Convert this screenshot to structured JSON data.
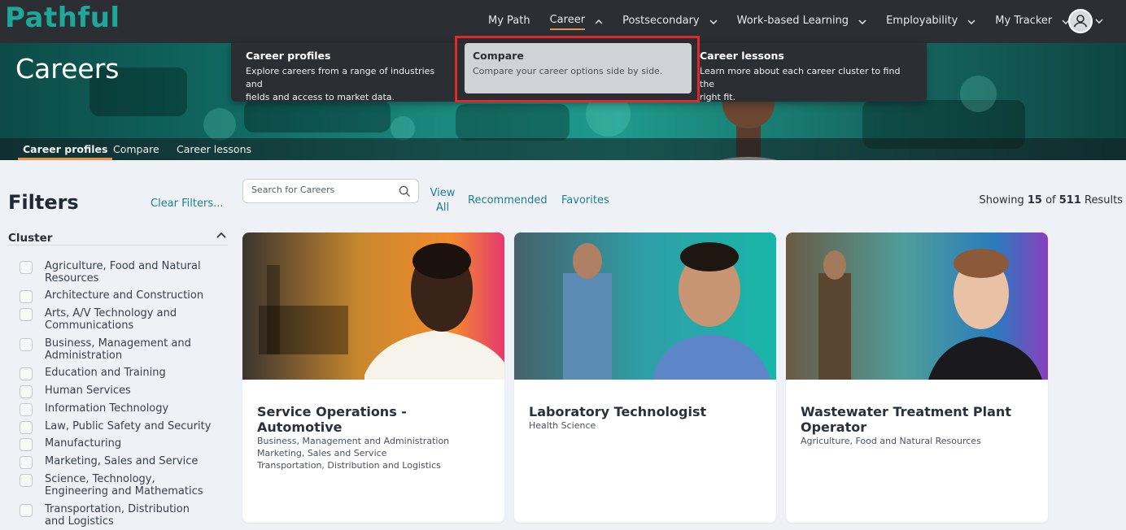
{
  "brand": {
    "logo": "Pathful"
  },
  "nav": {
    "items": [
      {
        "label": "My Path",
        "has_chevron": false,
        "active": false
      },
      {
        "label": "Career",
        "has_chevron": true,
        "chevron": "up",
        "active": true
      },
      {
        "label": "Postsecondary",
        "has_chevron": true,
        "chevron": "down",
        "active": false
      },
      {
        "label": "Work-based Learning",
        "has_chevron": true,
        "chevron": "down",
        "active": false
      },
      {
        "label": "Employability",
        "has_chevron": true,
        "chevron": "down",
        "active": false
      },
      {
        "label": "My Tracker",
        "has_chevron": true,
        "chevron": "down",
        "active": false
      }
    ],
    "avatar_icon": "user-avatar-icon"
  },
  "dropdown": {
    "items": [
      {
        "title": "Career profiles",
        "desc_line1": "Explore careers from a range of industries and",
        "desc_line2": "fields and access to market data."
      },
      {
        "title": "Compare",
        "desc_line1": "Compare your career options side by side.",
        "desc_line2": ""
      },
      {
        "title": "Career lessons",
        "desc_line1": "Learn more about each career cluster to find the",
        "desc_line2": "right fit."
      }
    ],
    "highlighted": "Compare"
  },
  "hero": {
    "title": "Careers",
    "tabs": [
      {
        "label": "Career profiles",
        "active": true
      },
      {
        "label": "Compare",
        "active": false
      },
      {
        "label": "Career lessons",
        "active": false
      }
    ]
  },
  "filters": {
    "title": "Filters",
    "clear_label": "Clear Filters...",
    "cluster_label": "Cluster",
    "clusters": [
      "Agriculture, Food and Natural Resources",
      "Architecture and Construction",
      "Arts, A/V Technology and Communications",
      "Business, Management and Administration",
      "Education and Training",
      "Human Services",
      "Information Technology",
      "Law, Public Safety and Security",
      "Manufacturing",
      "Marketing, Sales and Service",
      "Science, Technology, Engineering and Mathematics",
      "Transportation, Distribution and Logistics"
    ]
  },
  "search": {
    "placeholder": "Search for Careers"
  },
  "view_filters": {
    "view_all": "View All",
    "recommended": "Recommended",
    "favorites": "Favorites"
  },
  "results": {
    "prefix": "Showing",
    "shown": "15",
    "of": "of",
    "total": "511",
    "suffix": "Results"
  },
  "cards": [
    {
      "title": "Service Operations - Automotive",
      "clusters": [
        "Business, Management and Administration",
        "Marketing, Sales and Service",
        "Transportation, Distribution and Logistics"
      ]
    },
    {
      "title": "Laboratory Technologist",
      "clusters": [
        "Health Science"
      ]
    },
    {
      "title": "Wastewater Treatment Plant Operator",
      "clusters": [
        "Agriculture, Food and Natural Resources"
      ]
    }
  ],
  "colors": {
    "nav_bg": "#2b2e33",
    "accent": "#e9904a",
    "link": "#1d7f95",
    "brand": "#1ea89a",
    "highlight_border": "#e02a2a"
  }
}
